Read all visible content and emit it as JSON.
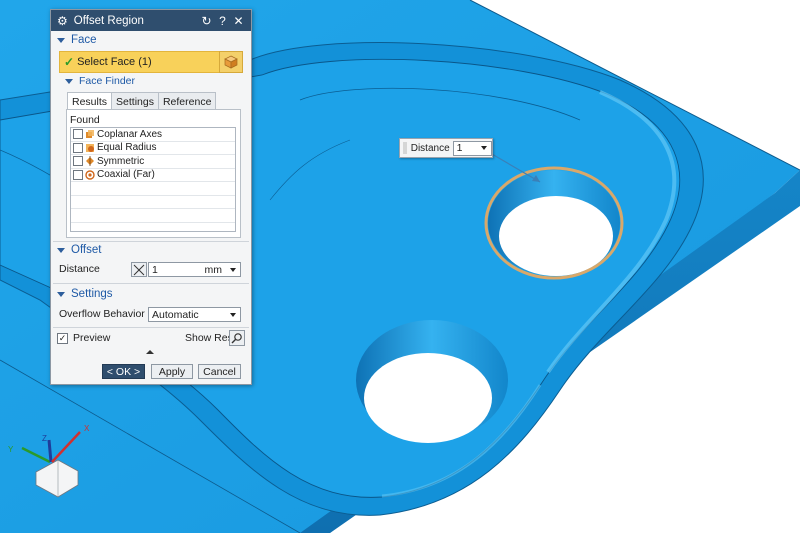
{
  "dialog": {
    "title": "Offset Region",
    "face_group": {
      "header": "Face",
      "select_face": "Select Face (1)",
      "face_finder": {
        "header": "Face Finder",
        "tabs": [
          "Results",
          "Settings",
          "Reference"
        ],
        "found_label": "Found",
        "items": [
          "Coplanar Axes",
          "Equal Radius",
          "Symmetric",
          "Coaxial (Far)"
        ]
      }
    },
    "offset_group": {
      "header": "Offset",
      "distance_label": "Distance",
      "distance_value": "1",
      "distance_unit": "mm"
    },
    "settings_group": {
      "header": "Settings",
      "overflow_label": "Overflow Behavior",
      "overflow_value": "Automatic"
    },
    "preview_label": "Preview",
    "show_result_label": "Show Result",
    "buttons": {
      "ok": "< OK >",
      "apply": "Apply",
      "cancel": "Cancel"
    }
  },
  "distance_popup": {
    "label": "Distance",
    "value": "1"
  },
  "triad": {
    "x": "X",
    "y": "Y",
    "z": "Z"
  },
  "colors": {
    "part": "#1a9be0",
    "titlebar": "#2f4e6e",
    "select_highlight": "#f8d15a",
    "selection_edge": "#d9a86a"
  }
}
